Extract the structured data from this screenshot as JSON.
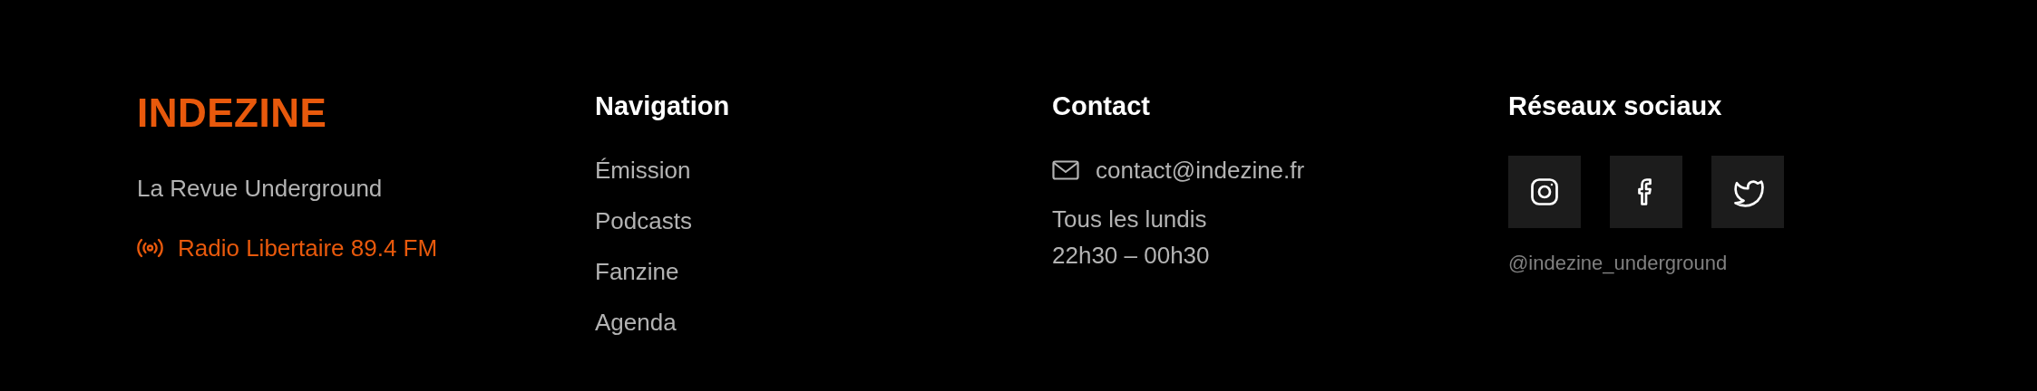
{
  "brand": {
    "logo": "INDEZINE",
    "tagline": "La Revue Underground",
    "radio": "Radio Libertaire 89.4 FM"
  },
  "navigation": {
    "heading": "Navigation",
    "links": [
      "Émission",
      "Podcasts",
      "Fanzine",
      "Agenda"
    ]
  },
  "contact": {
    "heading": "Contact",
    "email": "contact@indezine.fr",
    "schedule": [
      "Tous les lundis",
      "22h30 – 00h30"
    ]
  },
  "social": {
    "heading": "Réseaux sociaux",
    "links": [
      {
        "kind": "instagram"
      },
      {
        "kind": "facebook"
      },
      {
        "kind": "twitter"
      }
    ],
    "handle": "@indezine_underground"
  }
}
